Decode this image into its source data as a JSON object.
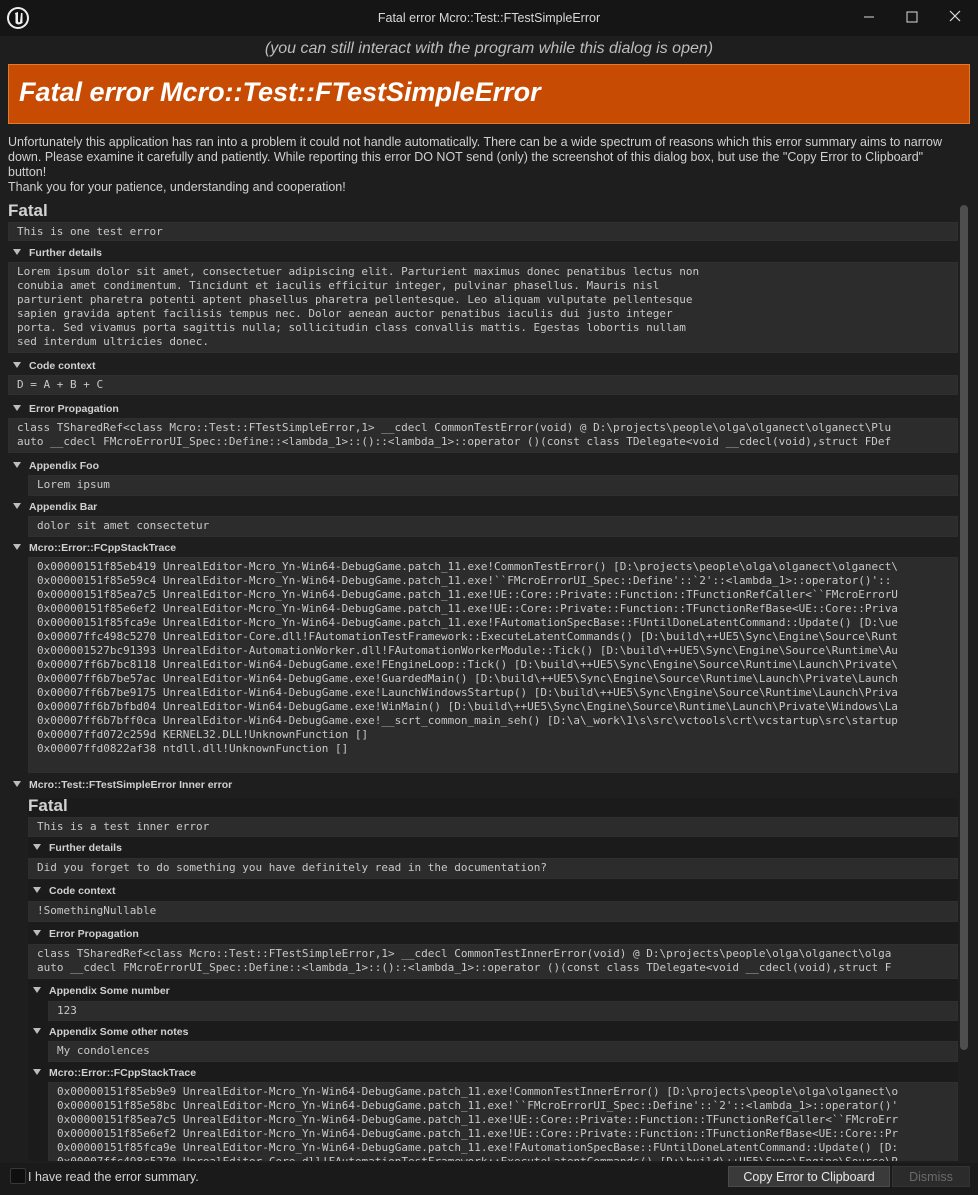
{
  "window": {
    "title": "Fatal error Mcro::Test::FTestSimpleError",
    "subtitle": "(you can still interact with the program while this dialog is open)"
  },
  "banner": {
    "title": "Fatal error Mcro::Test::FTestSimpleError",
    "color": "#c84b04"
  },
  "intro": {
    "paragraph": "Unfortunately this application has ran into a problem it could not handle automatically. There can be a wide spectrum of reasons which this error summary aims to narrow down. Please examine it carefully and patiently. While reporting this error DO NOT send (only) the screenshot of this dialog box, but use the \"Copy Error to Clipboard\" button!",
    "thanks": "Thank you for your patience, understanding and cooperation!"
  },
  "error": {
    "severity": "Fatal",
    "message": "This is one test error",
    "further_details_label": "Further details",
    "further_details": "Lorem ipsum dolor sit amet, consectetuer adipiscing elit. Parturient maximus donec penatibus lectus non\nconubia amet condimentum. Tincidunt et iaculis efficitur integer, pulvinar phasellus. Mauris nisl\nparturient pharetra potenti aptent phasellus pharetra pellentesque. Leo aliquam vulputate pellentesque\nsapien gravida aptent facilisis tempus nec. Dolor aenean auctor penatibus iaculis dui justo integer\nporta. Sed vivamus porta sagittis nulla; sollicitudin class convallis mattis. Egestas lobortis nullam\nsed interdum ultricies donec.",
    "code_context_label": "Code context",
    "code_context": "D = A + B + C",
    "propagation_label": "Error Propagation",
    "propagation": "class TSharedRef<class Mcro::Test::FTestSimpleError,1> __cdecl CommonTestError(void) @ D:\\projects\\people\\olga\\olganect\\olganect\\Plu\nauto __cdecl FMcroErrorUI_Spec::Define::<lambda_1>::()::<lambda_1>::operator ()(const class TDelegate<void __cdecl(void),struct FDef",
    "appendix_foo_label": "Appendix Foo",
    "appendix_foo": "Lorem ipsum",
    "appendix_bar_label": "Appendix Bar",
    "appendix_bar": "dolor sit amet consectetur",
    "stack_label": "Mcro::Error::FCppStackTrace",
    "stack": "0x00000151f85eb419 UnrealEditor-Mcro_Yn-Win64-DebugGame.patch_11.exe!CommonTestError() [D:\\projects\\people\\olga\\olganect\\olganect\\\n0x00000151f85e59c4 UnrealEditor-Mcro_Yn-Win64-DebugGame.patch_11.exe!``FMcroErrorUI_Spec::Define'::`2'::<lambda_1>::operator()'::\n0x00000151f85ea7c5 UnrealEditor-Mcro_Yn-Win64-DebugGame.patch_11.exe!UE::Core::Private::Function::TFunctionRefCaller<``FMcroErrorU\n0x00000151f85e6ef2 UnrealEditor-Mcro_Yn-Win64-DebugGame.patch_11.exe!UE::Core::Private::Function::TFunctionRefBase<UE::Core::Priva\n0x00000151f85fca9e UnrealEditor-Mcro_Yn-Win64-DebugGame.patch_11.exe!FAutomationSpecBase::FUntilDoneLatentCommand::Update() [D:\\ue\n0x00007ffc498c5270 UnrealEditor-Core.dll!FAutomationTestFramework::ExecuteLatentCommands() [D:\\build\\++UE5\\Sync\\Engine\\Source\\Runt\n0x000001527bc91393 UnrealEditor-AutomationWorker.dll!FAutomationWorkerModule::Tick() [D:\\build\\++UE5\\Sync\\Engine\\Source\\Runtime\\Au\n0x00007ff6b7bc8118 UnrealEditor-Win64-DebugGame.exe!FEngineLoop::Tick() [D:\\build\\++UE5\\Sync\\Engine\\Source\\Runtime\\Launch\\Private\\\n0x00007ff6b7be57ac UnrealEditor-Win64-DebugGame.exe!GuardedMain() [D:\\build\\++UE5\\Sync\\Engine\\Source\\Runtime\\Launch\\Private\\Launch\n0x00007ff6b7be9175 UnrealEditor-Win64-DebugGame.exe!LaunchWindowsStartup() [D:\\build\\++UE5\\Sync\\Engine\\Source\\Runtime\\Launch\\Priva\n0x00007ff6b7bfbd04 UnrealEditor-Win64-DebugGame.exe!WinMain() [D:\\build\\++UE5\\Sync\\Engine\\Source\\Runtime\\Launch\\Private\\Windows\\La\n0x00007ff6b7bff0ca UnrealEditor-Win64-DebugGame.exe!__scrt_common_main_seh() [D:\\a\\_work\\1\\s\\src\\vctools\\crt\\vcstartup\\src\\startup\n0x00007ffd072c259d KERNEL32.DLL!UnknownFunction []\n0x00007ffd0822af38 ntdll.dll!UnknownFunction []",
    "inner_label": "Mcro::Test::FTestSimpleError Inner error"
  },
  "inner": {
    "severity": "Fatal",
    "message": "This is a test inner error",
    "further_details_label": "Further details",
    "further_details": "Did you forget to do something you have definitely read in the documentation?",
    "code_context_label": "Code context",
    "code_context": "!SomethingNullable",
    "propagation_label": "Error Propagation",
    "propagation": "class TSharedRef<class Mcro::Test::FTestSimpleError,1> __cdecl CommonTestInnerError(void) @ D:\\projects\\people\\olga\\olganect\\olga\nauto __cdecl FMcroErrorUI_Spec::Define::<lambda_1>::()::<lambda_1>::operator ()(const class TDelegate<void __cdecl(void),struct F",
    "appendix_number_label": "Appendix Some number",
    "appendix_number": "123",
    "appendix_notes_label": "Appendix Some other notes",
    "appendix_notes": "My condolences",
    "stack_label": "Mcro::Error::FCppStackTrace",
    "stack": "0x00000151f85eb9e9 UnrealEditor-Mcro_Yn-Win64-DebugGame.patch_11.exe!CommonTestInnerError() [D:\\projects\\people\\olga\\olganect\\o\n0x00000151f85e58bc UnrealEditor-Mcro_Yn-Win64-DebugGame.patch_11.exe!``FMcroErrorUI_Spec::Define'::`2'::<lambda_1>::operator()'\n0x00000151f85ea7c5 UnrealEditor-Mcro_Yn-Win64-DebugGame.patch_11.exe!UE::Core::Private::Function::TFunctionRefCaller<``FMcroErr\n0x00000151f85e6ef2 UnrealEditor-Mcro_Yn-Win64-DebugGame.patch_11.exe!UE::Core::Private::Function::TFunctionRefBase<UE::Core::Pr\n0x00000151f85fca9e UnrealEditor-Mcro_Yn-Win64-DebugGame.patch_11.exe!FAutomationSpecBase::FUntilDoneLatentCommand::Update() [D:\n0x00007ffc498c5270 UnrealEditor-Core.dll!FAutomationTestFramework::ExecuteLatentCommands() [D:\\build\\++UE5\\Sync\\Engine\\Source\\R"
  },
  "footer": {
    "checkbox_label": "I have read the error summary.",
    "copy_label": "Copy Error to Clipboard",
    "dismiss_label": "Dismiss"
  },
  "icons": {
    "logo": "unreal-engine-logo",
    "minimize": "minimize-icon",
    "maximize": "maximize-icon",
    "close": "close-icon",
    "collapse": "triangle-down-icon"
  }
}
